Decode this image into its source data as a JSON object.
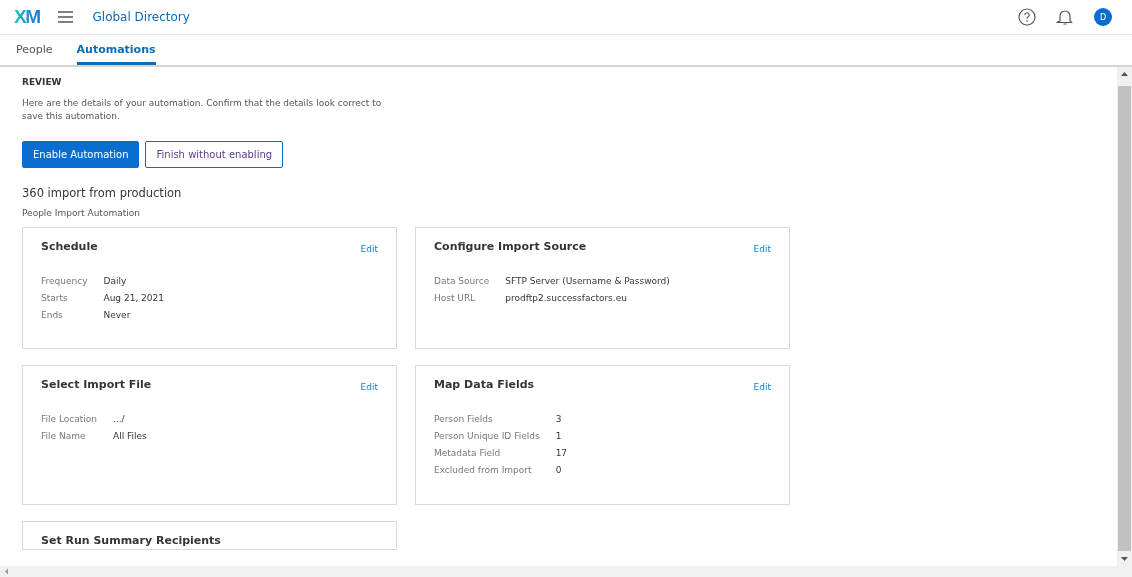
{
  "header": {
    "logo": "XM",
    "title": "Global Directory",
    "avatar": "D"
  },
  "tabs": [
    {
      "label": "People",
      "selected": false
    },
    {
      "label": "Automations",
      "selected": true
    }
  ],
  "review": {
    "heading": "REVIEW",
    "description": "Here are the details of your automation. Confirm that the details look correct to save this automation.",
    "buttons": [
      {
        "label": "Enable Automation",
        "kind": "primary"
      },
      {
        "label": "Finish without enabling",
        "kind": "secondary"
      }
    ],
    "name": "360 import from production",
    "type": "People Import Automation"
  },
  "cards": [
    {
      "title": "Schedule",
      "action": "Edit",
      "fields": [
        {
          "label": "Frequency",
          "value": "Daily"
        },
        {
          "label": "Starts",
          "value": "Aug 21, 2021"
        },
        {
          "label": "Ends",
          "value": "Never"
        }
      ]
    },
    {
      "title": "Configure Import Source",
      "action": "Edit",
      "fields": [
        {
          "label": "Data Source",
          "value": "SFTP Server (Username & Password)"
        },
        {
          "label": "Host URL",
          "value": "prodftp2.successfactors.eu"
        }
      ]
    },
    {
      "title": "Select Import File",
      "action": "Edit",
      "fields": [
        {
          "label": "File Location",
          "value": ".../"
        },
        {
          "label": "File Name",
          "value": "All Files"
        }
      ]
    },
    {
      "title": "Map Data Fields",
      "action": "Edit",
      "fields": [
        {
          "label": "Person Fields",
          "value": "3"
        },
        {
          "label": "Person Unique ID Fields",
          "value": "1"
        },
        {
          "label": "Metadata Field",
          "value": "17"
        },
        {
          "label": "Excluded from Import",
          "value": "0"
        }
      ]
    },
    {
      "title": "Set Run Summary Recipients"
    }
  ]
}
